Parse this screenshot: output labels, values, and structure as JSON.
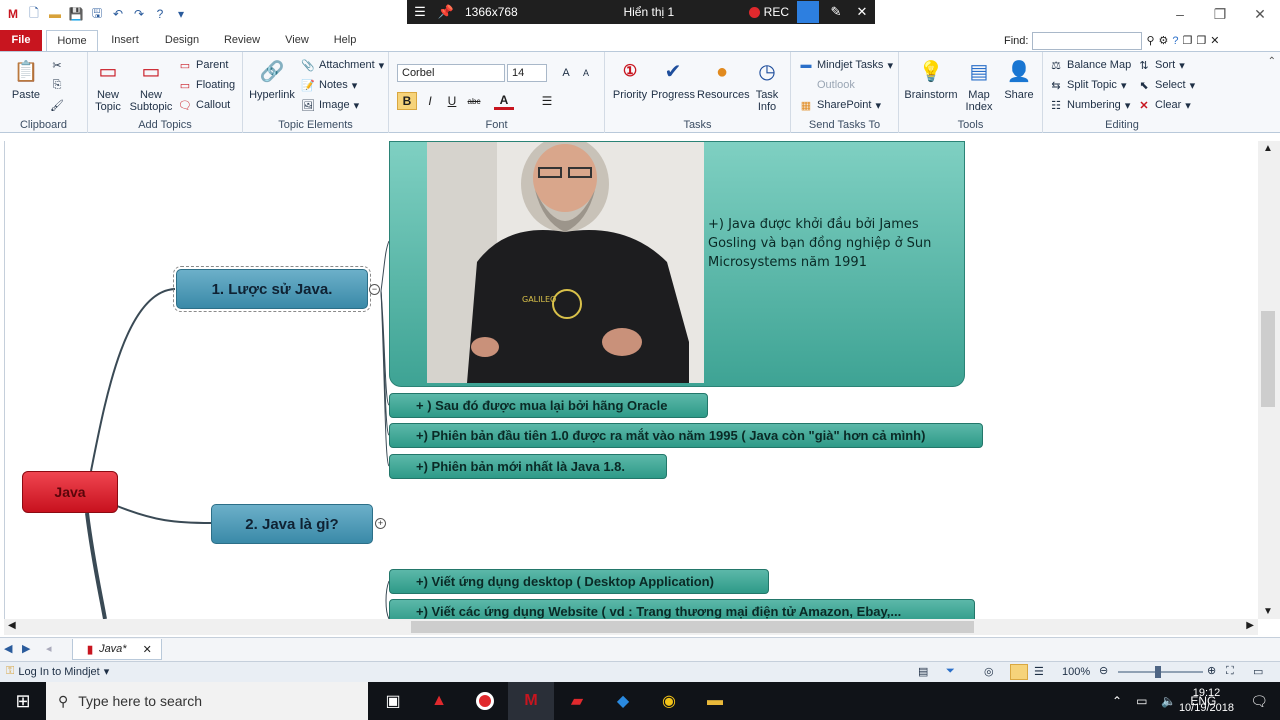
{
  "recorder": {
    "resolution": "1366x768",
    "display": "Hiển thị 1",
    "rec_label": "REC"
  },
  "tabs": {
    "file": "File",
    "home": "Home",
    "insert": "Insert",
    "design": "Design",
    "review": "Review",
    "view": "View",
    "help": "Help"
  },
  "find": {
    "label": "Find:",
    "value": ""
  },
  "ribbon": {
    "clipboard": {
      "paste": "Paste",
      "label": "Clipboard"
    },
    "add_topics": {
      "new_topic": [
        "New",
        "Topic"
      ],
      "new_subtopic": [
        "New",
        "Subtopic"
      ],
      "parent": "Parent",
      "floating": "Floating",
      "callout": "Callout",
      "label": "Add Topics"
    },
    "topic_elements": {
      "hyperlink": "Hyperlink",
      "attachment": "Attachment",
      "notes": "Notes",
      "image": "Image",
      "label": "Topic Elements"
    },
    "font": {
      "family": "Corbel",
      "size": "14",
      "bold": "B",
      "italic": "I",
      "underline": "U",
      "strike": "abc",
      "color": "A",
      "label": "Font"
    },
    "tasks": {
      "priority": "Priority",
      "progress": "Progress",
      "resources": "Resources",
      "task_info": [
        "Task",
        "Info"
      ],
      "label": "Tasks"
    },
    "send_tasks": {
      "mindjet_tasks": "Mindjet Tasks",
      "outlook": "Outlook",
      "sharepoint": "SharePoint",
      "label": "Send Tasks To"
    },
    "tools": {
      "brainstorm": "Brainstorm",
      "map_index": [
        "Map",
        "Index"
      ],
      "share": "Share",
      "label": "Tools"
    },
    "editing": {
      "balance_map": "Balance Map",
      "split_topic": "Split Topic",
      "numbering": "Numbering",
      "sort": "Sort",
      "select": "Select",
      "clear": "Clear",
      "label": "Editing"
    }
  },
  "map": {
    "central": "Java",
    "topic1": "1. Lược sử Java.",
    "topic2": "2. Java là gì?",
    "card_text": "+) Java được khởi đầu bởi James Gosling và bạn đồng nghiệp ở Sun Microsystems năm 1991",
    "photo_shirt_text": "GALILEO",
    "sub1": "+ ) Sau đó được mua lại bởi hãng Oracle",
    "sub2": "+) Phiên bản đầu tiên 1.0 được ra mắt vào năm 1995 ( Java còn \"già\" hơn cả mình)",
    "sub3": "+) Phiên bản mới nhất là Java 1.8.",
    "sub4": "+) Viết ứng dụng desktop ( Desktop Application)",
    "sub5": "+) Viết các ứng dụng Website ( vd : Trang thương mại điện tử Amazon, Ebay,..."
  },
  "doc_tab": {
    "name": "Java*"
  },
  "status": {
    "login": "Log In to Mindjet",
    "zoom": "100%"
  },
  "taskbar": {
    "search_placeholder": "Type here to search",
    "lang": "ENG",
    "time": "19:12",
    "date": "10/19/2018"
  },
  "colors": {
    "file_tab": "#c8151f",
    "main_topic": "#3a8aa8",
    "central": "#c8111e",
    "subtopic": "#2e9a88"
  }
}
